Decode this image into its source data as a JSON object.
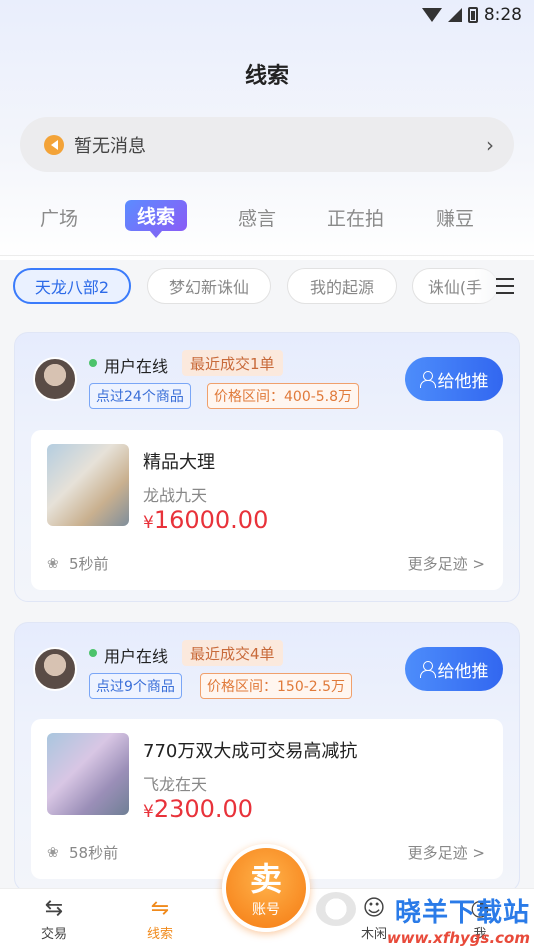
{
  "status_bar": {
    "time": "8:28"
  },
  "page_title": "线索",
  "notice": {
    "text": "暂无消息"
  },
  "tabs": [
    {
      "label": "广场"
    },
    {
      "label": "线索"
    },
    {
      "label": "感言"
    },
    {
      "label": "正在拍"
    },
    {
      "label": "赚豆"
    }
  ],
  "filters": [
    {
      "label": "天龙八部2"
    },
    {
      "label": "梦幻新诛仙"
    },
    {
      "label": "我的起源"
    },
    {
      "label": "诛仙(手"
    }
  ],
  "cards": [
    {
      "online": "用户在线",
      "deals": "最近成交1单",
      "viewed": "点过24个商品",
      "price_range": "价格区间：400-5.8万",
      "push_label": "给他推",
      "item": {
        "name": "精品大理",
        "server": "龙战九天",
        "price_yen": "¥",
        "price": "16000.00"
      },
      "time": "5秒前",
      "more": "更多足迹 >"
    },
    {
      "online": "用户在线",
      "deals": "最近成交4单",
      "viewed": "点过9个商品",
      "price_range": "价格区间：150-2.5万",
      "push_label": "给他推",
      "item": {
        "name": "770万双大成可交易高减抗",
        "server": "飞龙在天",
        "price_yen": "¥",
        "price": "2300.00"
      },
      "time": "58秒前",
      "more": "更多足迹 >"
    }
  ],
  "bottom_nav": [
    {
      "label": "交易",
      "icon": "trade-icon"
    },
    {
      "label": "线索",
      "icon": "clue-icon"
    },
    {
      "label": "木闲",
      "icon": "idle-icon"
    },
    {
      "label": "我",
      "icon": "me-icon"
    }
  ],
  "sell": {
    "main": "卖",
    "sub": "账号"
  },
  "watermark": {
    "text": "晓羊下载站",
    "url": "www.xfhygs.com"
  },
  "colors": {
    "accent": "#3a7bfb",
    "price": "#e8323a",
    "sell": "#f57a12"
  }
}
